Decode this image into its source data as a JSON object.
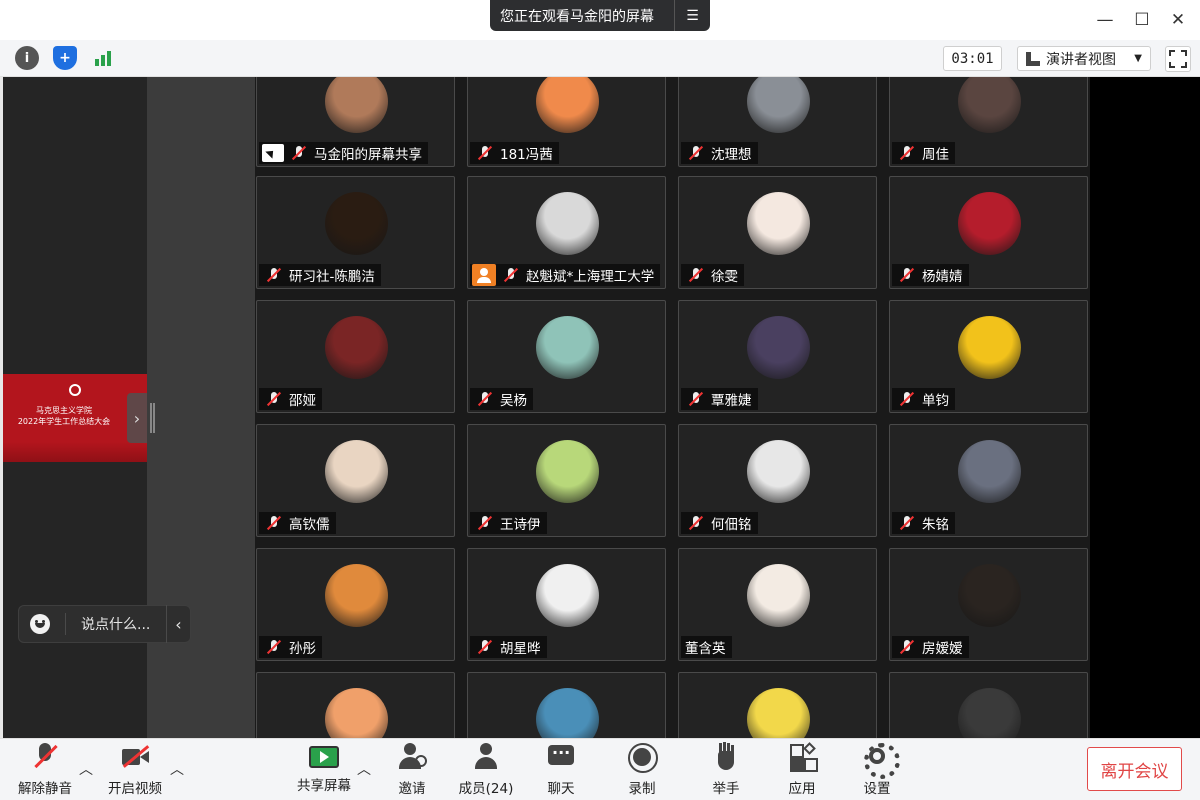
{
  "banner": {
    "text": "您正在观看马金阳的屏幕"
  },
  "toolbar": {
    "timer": "03:01",
    "view_mode": "演讲者视图"
  },
  "shared_screen": {
    "line1": "马克思主义学院",
    "line2": "2022年学生工作总结大会"
  },
  "chat": {
    "placeholder": "说点什么..."
  },
  "participants": [
    {
      "name": "马金阳的屏幕共享",
      "muted": true,
      "badge": "screen-share",
      "avatar": "#b07a5a"
    },
    {
      "name": "181冯茜",
      "muted": true,
      "badge": "",
      "avatar": "#f08a4b"
    },
    {
      "name": "沈理想",
      "muted": true,
      "badge": "",
      "avatar": "#8a8f96"
    },
    {
      "name": "周佳",
      "muted": true,
      "badge": "",
      "avatar": "#5a4540"
    },
    {
      "name": "研习社-陈鹏洁",
      "muted": true,
      "badge": "",
      "avatar": "#2a1c12"
    },
    {
      "name": "赵魁斌*上海理工大学",
      "muted": true,
      "badge": "person",
      "avatar": "#d9d9d9"
    },
    {
      "name": "徐雯",
      "muted": true,
      "badge": "",
      "avatar": "#f4e8e0"
    },
    {
      "name": "杨婧婧",
      "muted": true,
      "badge": "",
      "avatar": "#b51d2c"
    },
    {
      "name": "邵娅",
      "muted": true,
      "badge": "",
      "avatar": "#7a2525"
    },
    {
      "name": "吴杨",
      "muted": true,
      "badge": "",
      "avatar": "#8fc3b8"
    },
    {
      "name": "覃雅婕",
      "muted": true,
      "badge": "",
      "avatar": "#4a4060"
    },
    {
      "name": "单钧",
      "muted": true,
      "badge": "",
      "avatar": "#f2c21b"
    },
    {
      "name": "高钦儒",
      "muted": true,
      "badge": "",
      "avatar": "#e9d5c2"
    },
    {
      "name": "王诗伊",
      "muted": true,
      "badge": "",
      "avatar": "#b8d87a"
    },
    {
      "name": "何佃铭",
      "muted": true,
      "badge": "",
      "avatar": "#e7e7e7"
    },
    {
      "name": "朱铭",
      "muted": true,
      "badge": "",
      "avatar": "#6a7080"
    },
    {
      "name": "孙彤",
      "muted": true,
      "badge": "",
      "avatar": "#e08a3c"
    },
    {
      "name": "胡星晔",
      "muted": true,
      "badge": "",
      "avatar": "#f0f0f0"
    },
    {
      "name": "董含英",
      "muted": false,
      "badge": "",
      "avatar": "#f3ebe3"
    },
    {
      "name": "房嫒嫒",
      "muted": true,
      "badge": "",
      "avatar": "#2a2420"
    },
    {
      "name": "",
      "muted": true,
      "badge": "",
      "avatar": "#f0a06a"
    },
    {
      "name": "",
      "muted": true,
      "badge": "",
      "avatar": "#4a8fb8"
    },
    {
      "name": "",
      "muted": true,
      "badge": "",
      "avatar": "#f2d84a"
    },
    {
      "name": "",
      "muted": true,
      "badge": "",
      "avatar": "#3a3a3a"
    }
  ],
  "bottombar": {
    "unmute": "解除静音",
    "start_video": "开启视频",
    "share_screen": "共享屏幕",
    "invite": "邀请",
    "members": "成员(24)",
    "chat": "聊天",
    "record": "录制",
    "raise_hand": "举手",
    "apps": "应用",
    "settings": "设置",
    "leave": "离开会议"
  },
  "colors": {
    "leave": "#e04545",
    "share_green": "#2aa14b",
    "tile_bg": "#232323"
  }
}
